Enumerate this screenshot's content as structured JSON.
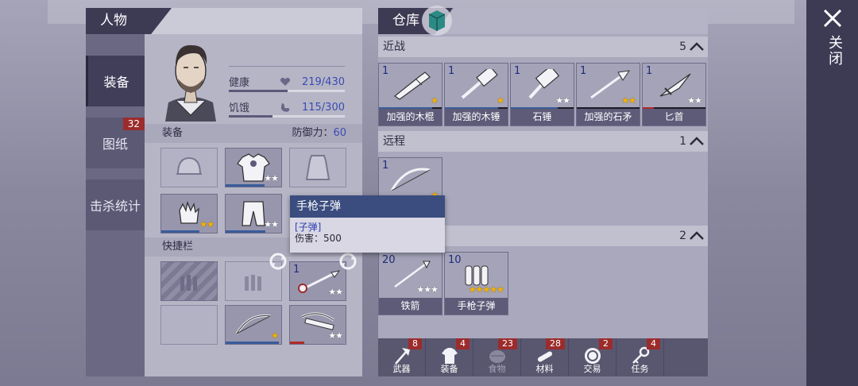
{
  "character": {
    "title": "人物",
    "tabs": [
      {
        "label": "装备",
        "badge": ""
      },
      {
        "label": "图纸",
        "badge": "32"
      },
      {
        "label": "击杀统计",
        "badge": ""
      }
    ],
    "stats": [
      {
        "label": "健康",
        "value": "219/430",
        "icon": "heart-icon",
        "fraction": 0.51
      },
      {
        "label": "饥饿",
        "value": "115/300",
        "icon": "stomach-icon",
        "fraction": 0.38
      }
    ],
    "equipment_label": "装备",
    "defense_label": "防御力：",
    "defense_value": "60",
    "quickbar_label": "快捷栏",
    "equipment_slots": [
      {
        "item": "helmet-icon",
        "empty": true
      },
      {
        "item": "armor-shirt-icon",
        "stars": "★★",
        "star_color": "white"
      },
      {
        "item": "cloak-icon",
        "empty": true
      },
      {
        "item": "gloves-icon",
        "stars": "★★",
        "star_color": "gold"
      },
      {
        "item": "armor-pants-icon",
        "stars": "★★",
        "star_color": "white"
      }
    ],
    "quick_slots": [
      {
        "item": "ammo-icon",
        "hatched": true
      },
      {
        "item": "ammo-icon",
        "empty": true
      },
      {
        "item": "spear-icon",
        "count": "1",
        "stars": "★★",
        "star_color": "white"
      },
      {
        "empty": true
      },
      {
        "item": "bow-icon",
        "stars": "★",
        "star_color": "gold"
      },
      {
        "item": "crossbow-icon",
        "stars": "★★",
        "star_color": "white"
      }
    ]
  },
  "tooltip": {
    "title": "手枪子弹",
    "type": "[子弹]",
    "damage": "伤害：500"
  },
  "storage": {
    "title": "仓库",
    "categories": [
      {
        "name": "近战",
        "count": "5",
        "items": [
          {
            "name": "加强的木棍",
            "count": "1",
            "stars": "★",
            "star_color": "gold",
            "durability": 0.85,
            "dur_color": "#3a5c9a"
          },
          {
            "name": "加强的木锤",
            "count": "1",
            "stars": "★",
            "star_color": "gold",
            "durability": 0.85,
            "dur_color": "#3a5c9a"
          },
          {
            "name": "石锤",
            "count": "1",
            "stars": "★★",
            "star_color": "white",
            "durability": 0.75,
            "dur_color": "#3a5c9a"
          },
          {
            "name": "加强的石矛",
            "count": "1",
            "stars": "★★",
            "star_color": "gold",
            "durability": 0.0,
            "dur_color": "#3a5c9a"
          },
          {
            "name": "匕首",
            "count": "1",
            "stars": "★★",
            "star_color": "white",
            "durability": 0.18,
            "dur_color": "#b02a2a"
          }
        ]
      },
      {
        "name": "远程",
        "count": "1",
        "items": [
          {
            "name": "",
            "count": "1",
            "stars": "★",
            "star_color": "gold"
          }
        ]
      },
      {
        "name": "",
        "count": "2",
        "items": [
          {
            "name": "铁箭",
            "count": "20",
            "stars": "★★★",
            "star_color": "white"
          },
          {
            "name": "手枪子弹",
            "count": "10",
            "stars": "★★★★★",
            "star_color": "gold"
          }
        ]
      }
    ],
    "bottom_tabs": [
      {
        "label": "武器",
        "badge": "8",
        "icon": "axe-icon"
      },
      {
        "label": "装备",
        "badge": "4",
        "icon": "shirt-icon"
      },
      {
        "label": "食物",
        "badge": "23",
        "icon": "food-icon"
      },
      {
        "label": "材料",
        "badge": "28",
        "icon": "wood-icon"
      },
      {
        "label": "交易",
        "badge": "2",
        "icon": "coin-icon"
      },
      {
        "label": "任务",
        "badge": "4",
        "icon": "key-icon"
      }
    ]
  },
  "close": {
    "label": "关闭"
  }
}
